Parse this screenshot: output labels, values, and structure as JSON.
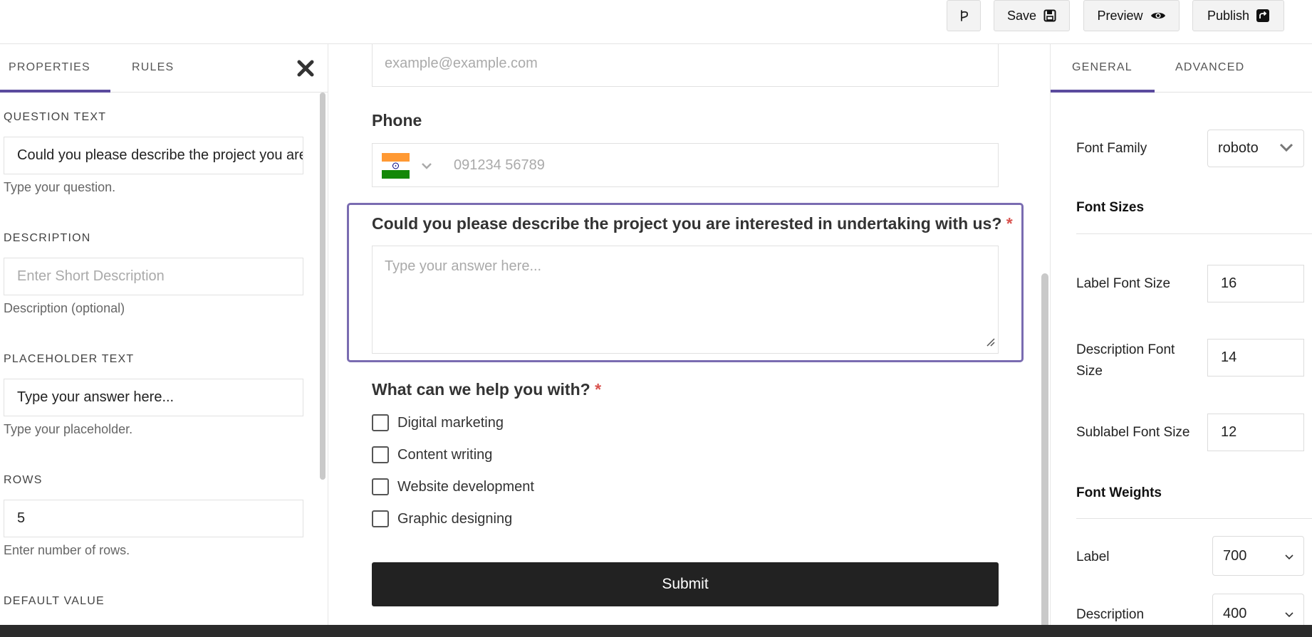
{
  "topbar": {
    "branch_icon_label": "",
    "save_label": "Save",
    "preview_label": "Preview",
    "publish_label": "Publish"
  },
  "left_panel": {
    "tabs": [
      {
        "label": "PROPERTIES",
        "active": true
      },
      {
        "label": "RULES",
        "active": false
      }
    ],
    "sections": {
      "question_text": {
        "title": "QUESTION TEXT",
        "value": "Could you please describe the project you are interested in undertaking with us?",
        "hint": "Type your question."
      },
      "description": {
        "title": "DESCRIPTION",
        "placeholder": "Enter Short Description",
        "hint": "Description (optional)"
      },
      "placeholder_text": {
        "title": "PLACEHOLDER TEXT",
        "value": "Type your answer here...",
        "hint": "Type your placeholder."
      },
      "rows": {
        "title": "ROWS",
        "value": "5",
        "hint": "Enter number of rows."
      },
      "default_value": {
        "title": "DEFAULT VALUE"
      }
    }
  },
  "form": {
    "email_placeholder": "example@example.com",
    "phone_label": "Phone",
    "phone_placeholder": "091234 56789",
    "question_label": "Could you please describe the project you are interested in undertaking with us?",
    "question_required": "*",
    "answer_placeholder": "Type your answer here...",
    "help_label": "What can we help you with?",
    "help_required": "*",
    "options": [
      {
        "label": "Digital marketing",
        "checked": false
      },
      {
        "label": "Content writing",
        "checked": false
      },
      {
        "label": "Website development",
        "checked": false
      },
      {
        "label": "Graphic designing",
        "checked": false
      }
    ],
    "submit_label": "Submit"
  },
  "right_panel": {
    "tabs": [
      {
        "label": "GENERAL",
        "active": true
      },
      {
        "label": "ADVANCED",
        "active": false
      }
    ],
    "font_family_label": "Font Family",
    "font_family_value": "roboto",
    "font_sizes_heading": "Font Sizes",
    "label_font_size_label": "Label Font Size",
    "label_font_size_value": "16",
    "description_font_size_label": "Description Font Size",
    "description_font_size_value": "14",
    "sublabel_font_size_label": "Sublabel Font Size",
    "sublabel_font_size_value": "12",
    "font_weights_heading": "Font Weights",
    "label_weight_label": "Label",
    "label_weight_value": "700",
    "description_weight_label": "Description",
    "description_weight_value": "400"
  },
  "colors": {
    "accent": "#5b4a9e",
    "selected_border": "#7a6cb1",
    "submit_bg": "#222222",
    "required": "#d9534f"
  }
}
